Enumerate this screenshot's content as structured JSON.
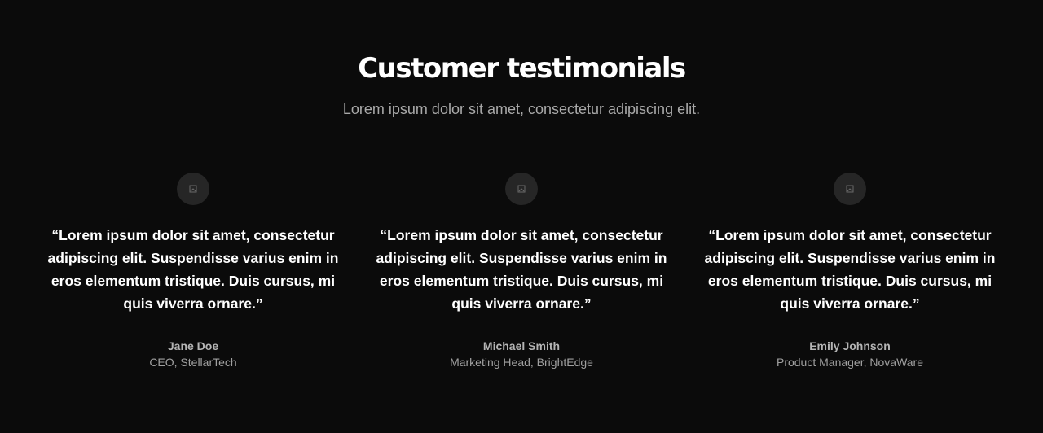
{
  "header": {
    "title": "Customer testimonials",
    "subtitle": "Lorem ipsum dolor sit amet, consectetur adipiscing elit."
  },
  "testimonials": [
    {
      "avatar_icon": "image-placeholder-icon",
      "quote": "“Lorem ipsum dolor sit amet, consectetur adipiscing elit. Suspendisse varius enim in eros elementum tristique. Duis cursus, mi quis viverra ornare.”",
      "name": "Jane Doe",
      "role": "CEO, StellarTech"
    },
    {
      "avatar_icon": "image-placeholder-icon",
      "quote": "“Lorem ipsum dolor sit amet, consectetur adipiscing elit. Suspendisse varius enim in eros elementum tristique. Duis cursus, mi quis viverra ornare.”",
      "name": "Michael Smith",
      "role": "Marketing Head, BrightEdge"
    },
    {
      "avatar_icon": "image-placeholder-icon",
      "quote": "“Lorem ipsum dolor sit amet, consectetur adipiscing elit. Suspendisse varius enim in eros elementum tristique. Duis cursus, mi quis viverra ornare.”",
      "name": "Emily Johnson",
      "role": "Product Manager, NovaWare"
    }
  ],
  "colors": {
    "background": "#0b0b0b",
    "text": "#ffffff",
    "muted": "#a9a9a9",
    "avatar_bg": "#262626"
  }
}
